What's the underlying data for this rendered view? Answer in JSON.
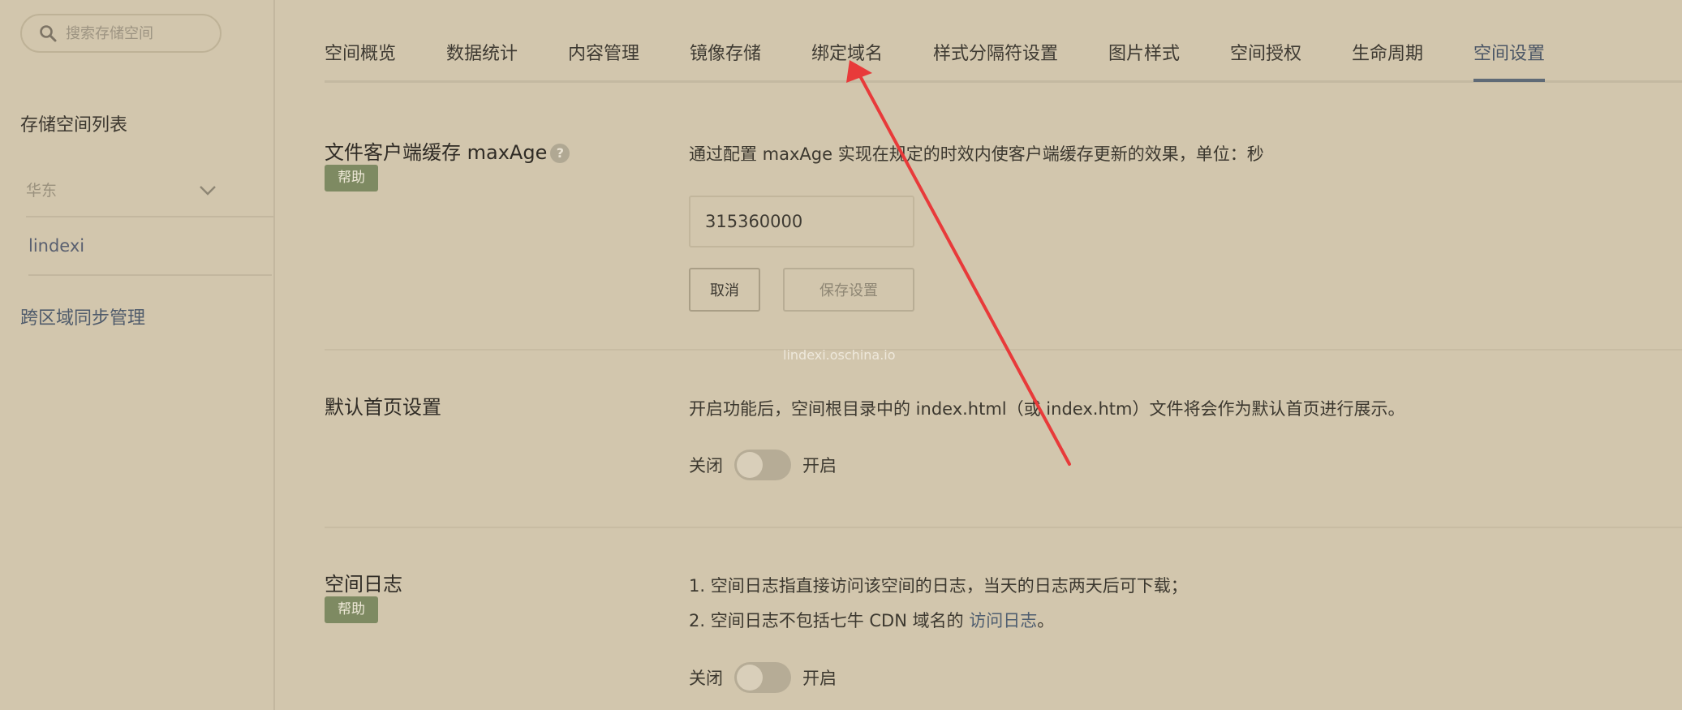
{
  "sidebar": {
    "search_placeholder": "搜索存储空间",
    "list_title": "存储空间列表",
    "region": "华东",
    "bucket": "lindexi",
    "sync_link": "跨区域同步管理"
  },
  "tabs": [
    {
      "label": "空间概览"
    },
    {
      "label": "数据统计"
    },
    {
      "label": "内容管理"
    },
    {
      "label": "镜像存储"
    },
    {
      "label": "绑定域名"
    },
    {
      "label": "样式分隔符设置"
    },
    {
      "label": "图片样式"
    },
    {
      "label": "空间授权"
    },
    {
      "label": "生命周期"
    },
    {
      "label": "空间设置",
      "active": true
    }
  ],
  "max_age": {
    "title": "文件客户端缓存 maxAge",
    "help_icon": "question-icon",
    "help_badge": "帮助",
    "description": "通过配置 maxAge 实现在规定的时效内使客户端缓存更新的效果，单位：秒",
    "value": "315360000",
    "cancel_label": "取消",
    "save_label": "保存设置"
  },
  "watermark": "lindexi.oschina.io",
  "default_index": {
    "title": "默认首页设置",
    "description": "开启功能后，空间根目录中的 index.html（或 index.htm）文件将会作为默认首页进行展示。",
    "off_label": "关闭",
    "on_label": "开启",
    "enabled": false
  },
  "space_log": {
    "title": "空间日志",
    "help_badge": "帮助",
    "line1": "1. 空间日志指直接访问该空间的日志，当天的日志两天后可下载；",
    "line2_prefix": "2. 空间日志不包括七牛 CDN 域名的 ",
    "line2_link": "访问日志",
    "line2_suffix": "。",
    "off_label": "关闭",
    "on_label": "开启",
    "enabled": false
  },
  "annotation_color": "#e83a3a",
  "colors": {
    "background": "#d2c6ad",
    "help_badge": "#7e8a62",
    "active_tab": "#5f6a76"
  }
}
